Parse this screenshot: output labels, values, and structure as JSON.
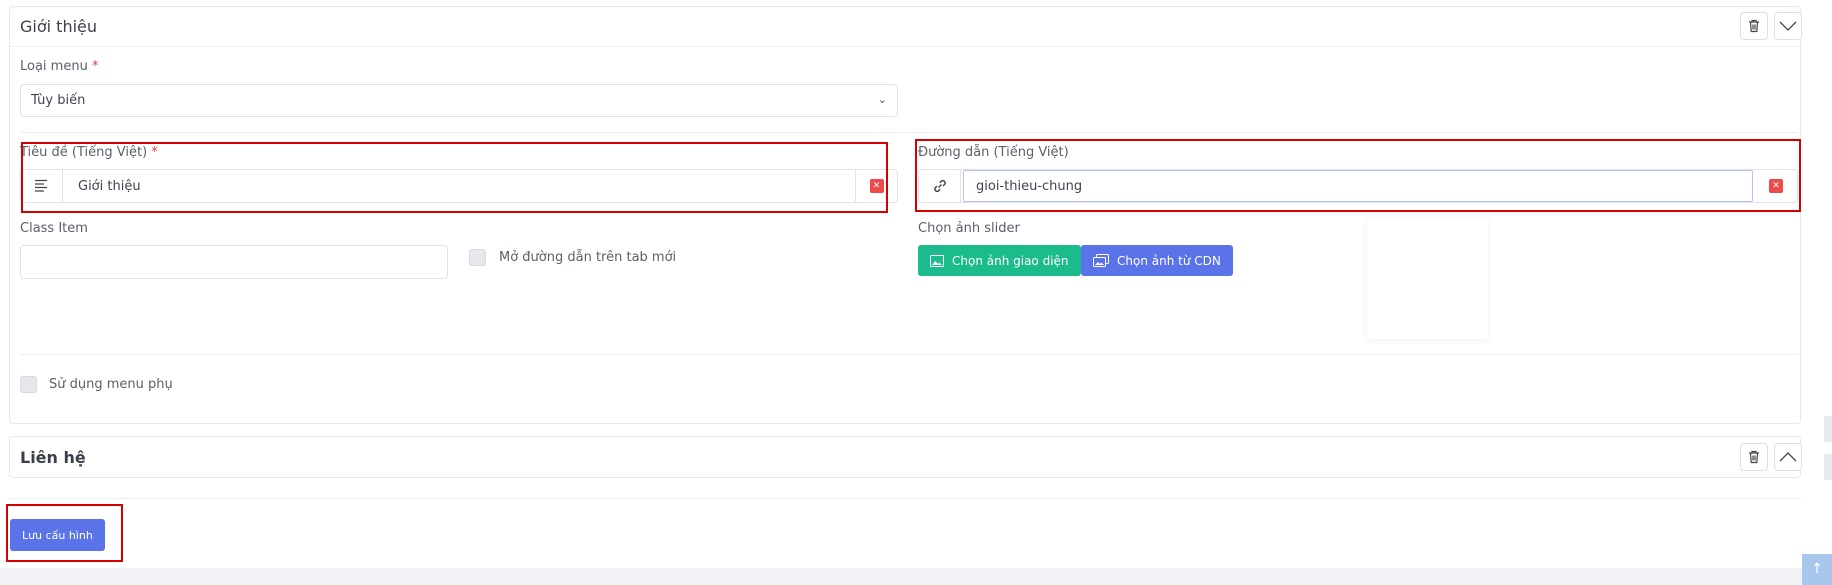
{
  "card1": {
    "title": "Giới thiệu",
    "menu_type_label": "Loại menu",
    "required_mark": "*",
    "menu_type_value": "Tùy biến",
    "title_vi_label": "Tiêu đề (Tiếng Việt)",
    "title_vi_value": "Giới thiệu",
    "path_vi_label": "Đường dẫn (Tiếng Việt)",
    "path_vi_value": "gioi-thieu-chung",
    "class_item_label": "Class Item",
    "class_item_value": "",
    "open_new_tab_label": "Mở đường dẫn trên tab mới",
    "slider_label": "Chọn ảnh slider",
    "choose_theme_image": "Chọn ảnh giao diện",
    "choose_cdn_image": "Chọn ảnh từ CDN",
    "submenu_label": "Sử dụng menu phụ"
  },
  "card2": {
    "title": "Liên hệ"
  },
  "save_button": "Lưu cấu hình",
  "icons": {
    "trash": "trash-icon",
    "chevron_down": "chevron-down-icon",
    "chevron_up": "chevron-up-icon",
    "align": "align-left-icon",
    "link": "link-icon",
    "remove": "remove-icon",
    "image": "image-icon",
    "images": "images-icon",
    "arrow_up": "arrow-up-icon"
  },
  "colors": {
    "primary": "#5b73e8",
    "success": "#1cbb8c",
    "danger": "#ef4a4a",
    "highlight": "#d50000"
  }
}
